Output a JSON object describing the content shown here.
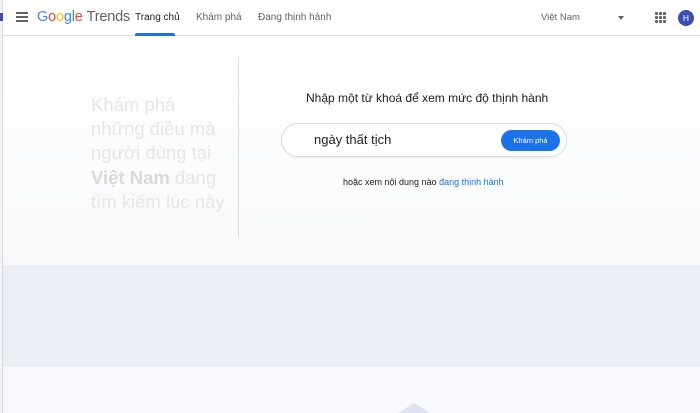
{
  "header": {
    "logo_letters": [
      "G",
      "o",
      "o",
      "g",
      "l",
      "e"
    ],
    "logo_trends": "Trends",
    "tabs": [
      {
        "label": "Trang chủ",
        "active": true
      },
      {
        "label": "Khám phá",
        "active": false
      },
      {
        "label": "Đang thịnh hành",
        "active": false
      }
    ],
    "region": "Việt Nam",
    "avatar_initial": "H"
  },
  "hero": {
    "tagline_part1": "Khám phá những điều mà người dùng tại",
    "tagline_country": "Việt Nam",
    "tagline_part2": "đang tìm kiếm lúc này",
    "prompt": "Nhập một từ khoá để xem mức độ thịnh hành",
    "search_value": "ngày thất tịch",
    "search_button": "Khám phá",
    "alt_text": "hoặc xem nội dung nào",
    "alt_link": "đang thịnh hành"
  },
  "icons": {
    "menu": "hamburger-menu-icon",
    "dropdown": "chevron-down-icon",
    "apps": "apps-grid-icon"
  },
  "colors": {
    "accent": "#1a73e8",
    "avatar": "#3c4db0",
    "band": "#eceef5"
  }
}
